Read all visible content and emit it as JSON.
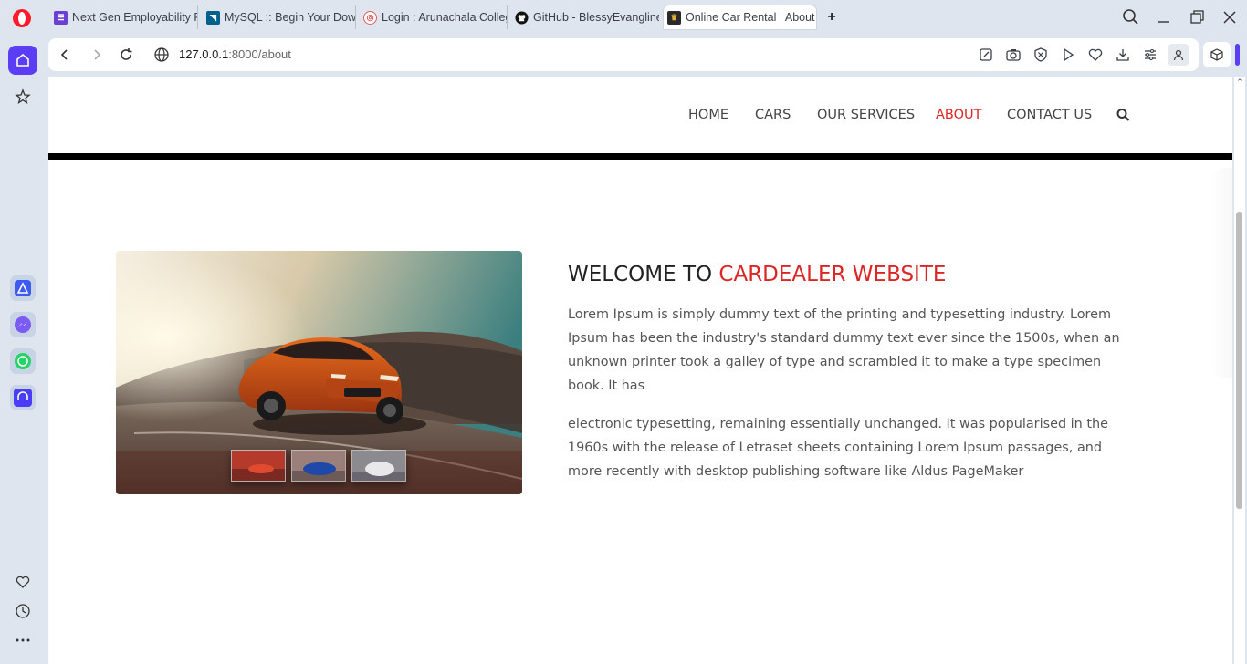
{
  "browser": {
    "tabs": [
      {
        "title": "Next Gen Employability Pr",
        "icon": "forms-icon",
        "color": "#6b3fd1"
      },
      {
        "title": "MySQL :: Begin Your Down",
        "icon": "mysql-icon",
        "color": "#00618a"
      },
      {
        "title": "Login : Arunachala College",
        "icon": "college-icon",
        "color": "#e35d5d"
      },
      {
        "title": "GitHub - BlessyEvangline/",
        "icon": "github-icon",
        "color": "#111111"
      },
      {
        "title": "Online Car Rental | About",
        "icon": "car-rental-icon",
        "color": "#2a2a2a",
        "active": true
      }
    ],
    "url": {
      "host": "127.0.0.1",
      "rest": ":8000/about"
    }
  },
  "site": {
    "nav": [
      {
        "label": "HOME",
        "active": false
      },
      {
        "label": "CARS",
        "active": false
      },
      {
        "label": "OUR SERVICES",
        "active": false
      },
      {
        "label": "ABOUT",
        "active": true
      },
      {
        "label": "CONTACT US",
        "active": false
      }
    ],
    "about": {
      "heading_prefix": "WELCOME TO ",
      "heading_accent": "CARDEALER WEBSITE",
      "paragraph1": "Lorem Ipsum is simply dummy text of the printing and typesetting industry. Lorem Ipsum has been the industry's standard dummy text ever since the 1500s, when an unknown printer took a galley of type and scrambled it to make a type specimen book. It has",
      "paragraph2": "electronic typesetting, remaining essentially unchanged. It was popularised in the 1960s with the release of Letraset sheets containing Lorem Ipsum passages, and more recently with desktop publishing software like Aldus PageMaker"
    }
  },
  "colors": {
    "accent": "#dc2626",
    "opera_purple": "#5b3df5"
  }
}
